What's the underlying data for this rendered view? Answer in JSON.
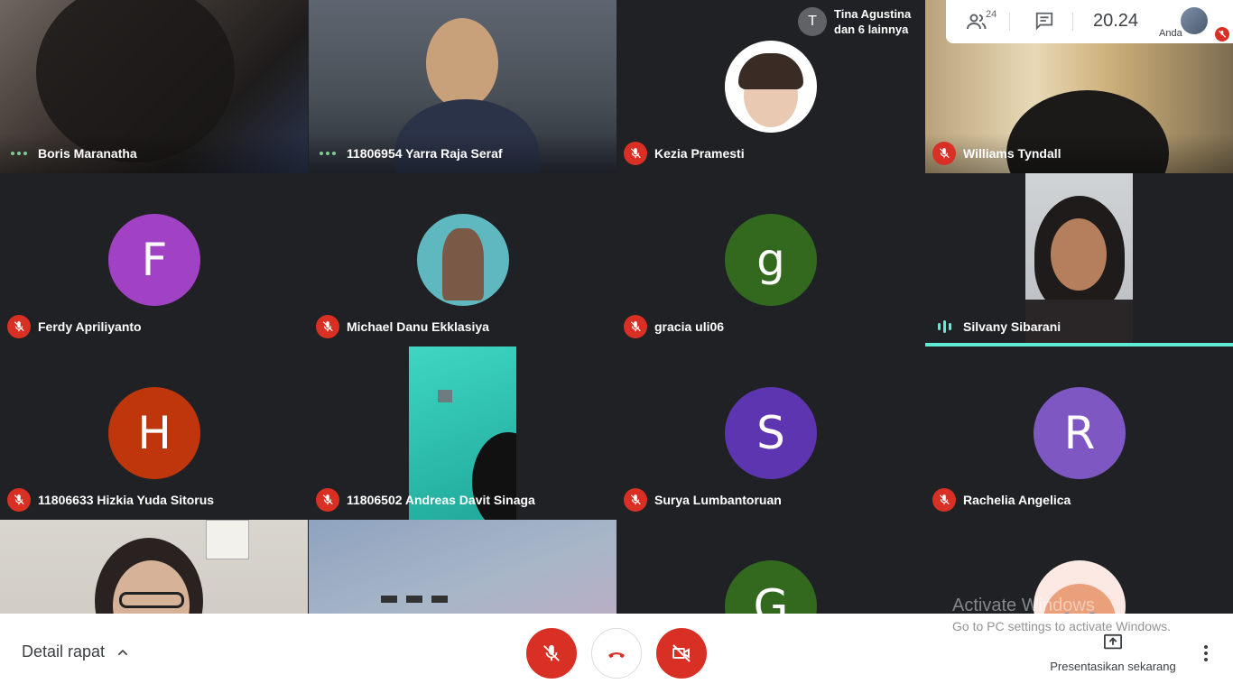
{
  "participants": [
    {
      "name": "Boris Maranatha",
      "status": "dots"
    },
    {
      "name": "11806954 Yarra Raja Seraf",
      "status": "dots"
    },
    {
      "name": "Kezia Pramesti",
      "status": "muted"
    },
    {
      "name": "Williams Tyndall",
      "status": "muted"
    },
    {
      "name": "Ferdy Apriliyanto",
      "status": "muted",
      "initial": "F",
      "color": "#a142c4"
    },
    {
      "name": "Michael Danu Ekklasiya",
      "status": "muted"
    },
    {
      "name": "gracia uli06",
      "status": "muted",
      "initial": "g",
      "color": "#33691e"
    },
    {
      "name": "Silvany Sibarani",
      "status": "speaking"
    },
    {
      "name": "11806633 Hizkia Yuda Sitorus",
      "status": "muted",
      "initial": "H",
      "color": "#bf360c"
    },
    {
      "name": "11806502 Andreas Davit Sinaga",
      "status": "muted"
    },
    {
      "name": "Surya Lumbantoruan",
      "status": "muted",
      "initial": "S",
      "color": "#5e35b1"
    },
    {
      "name": "Rachelia Angelica",
      "status": "muted",
      "initial": "R",
      "color": "#7e57c2"
    },
    {
      "initial": "G",
      "color": "#33691e"
    }
  ],
  "top_card": {
    "initial": "T",
    "line1": "Tina Agustina",
    "line2": "dan 6 lainnya"
  },
  "top_panel": {
    "people_count": "24",
    "time": "20.24",
    "self_label": "Anda"
  },
  "bottom_bar": {
    "meeting_details": "Detail rapat",
    "present_now": "Presentasikan sekarang"
  },
  "watermark": {
    "line1": "Activate Windows",
    "line2": "Go to PC settings to activate Windows."
  },
  "colors": {
    "muted": "#d93025",
    "speaking": "#5eecd2",
    "dots": "#81c995"
  }
}
